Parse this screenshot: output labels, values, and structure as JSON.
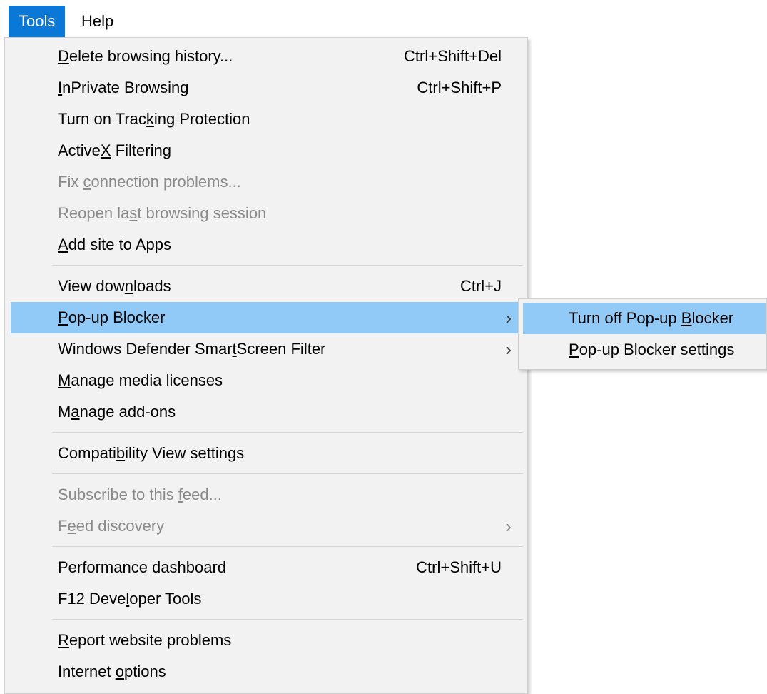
{
  "menubar": {
    "items": [
      {
        "label": "Tools"
      },
      {
        "label": "Help"
      }
    ]
  },
  "tools_menu": {
    "groups": [
      [
        {
          "label": "Delete browsing history...",
          "shortcut": "Ctrl+Shift+Del",
          "accesskey": "D"
        },
        {
          "label": "InPrivate Browsing",
          "shortcut": "Ctrl+Shift+P",
          "accesskey": "I"
        },
        {
          "label": "Turn on Tracking Protection",
          "accesskey": "k"
        },
        {
          "label": "ActiveX Filtering",
          "accesskey": "X"
        },
        {
          "label": "Fix connection problems...",
          "disabled": true,
          "accesskey": "c"
        },
        {
          "label": "Reopen last browsing session",
          "disabled": true,
          "accesskey": "s"
        },
        {
          "label": "Add site to Apps",
          "accesskey": "A"
        }
      ],
      [
        {
          "label": "View downloads",
          "shortcut": "Ctrl+J",
          "accesskey": "n"
        },
        {
          "label": "Pop-up Blocker",
          "submenu": true,
          "highlighted": true,
          "accesskey": "P"
        },
        {
          "label": "Windows Defender SmartScreen Filter",
          "submenu": true,
          "accesskey": "t"
        },
        {
          "label": "Manage media licenses",
          "accesskey": "M"
        },
        {
          "label": "Manage add-ons",
          "accesskey": "a"
        }
      ],
      [
        {
          "label": "Compatibility View settings",
          "accesskey": "b"
        }
      ],
      [
        {
          "label": "Subscribe to this feed...",
          "disabled": true,
          "accesskey": "f"
        },
        {
          "label": "Feed discovery",
          "disabled": true,
          "submenu": true,
          "accesskey": "e"
        }
      ],
      [
        {
          "label": "Performance dashboard",
          "shortcut": "Ctrl+Shift+U"
        },
        {
          "label": "F12 Developer Tools",
          "accesskey": "l"
        }
      ],
      [
        {
          "label": "Report website problems",
          "accesskey": "R"
        },
        {
          "label": "Internet options",
          "accesskey": "o"
        }
      ]
    ]
  },
  "popup_submenu": {
    "items": [
      {
        "label": "Turn off Pop-up Blocker",
        "highlighted": true,
        "accesskey": "B"
      },
      {
        "label": "Pop-up Blocker settings",
        "accesskey": "P"
      }
    ]
  },
  "colors": {
    "menubar_active": "#0a78d7",
    "item_highlight": "#91c9f7",
    "menu_background": "#f2f2f2",
    "disabled_text": "#8a8a8a"
  },
  "icons": {
    "submenu_arrow": "chevron-right-icon"
  }
}
